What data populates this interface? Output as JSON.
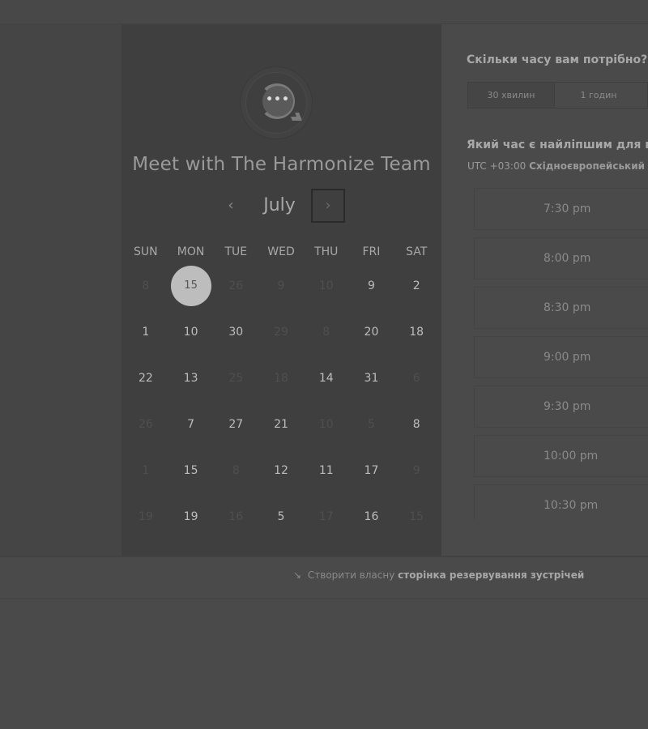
{
  "calendar": {
    "title": "Meet with The Harmonize Team",
    "logo_text": "•••",
    "month": "July",
    "prev_label": "‹",
    "next_label": "›",
    "days_of_week": [
      "SUN",
      "MON",
      "TUE",
      "WED",
      "THU",
      "FRI",
      "SAT"
    ],
    "weeks": [
      [
        {
          "d": "8",
          "m": true
        },
        {
          "d": "15",
          "sel": true
        },
        {
          "d": "26",
          "m": true
        },
        {
          "d": "9",
          "m": true
        },
        {
          "d": "10",
          "m": true
        },
        {
          "d": "9"
        },
        {
          "d": "2"
        }
      ],
      [
        {
          "d": "1"
        },
        {
          "d": "10"
        },
        {
          "d": "30"
        },
        {
          "d": "29",
          "m": true
        },
        {
          "d": "8",
          "m": true
        },
        {
          "d": "20"
        },
        {
          "d": "18"
        }
      ],
      [
        {
          "d": "22"
        },
        {
          "d": "13"
        },
        {
          "d": "25",
          "m": true
        },
        {
          "d": "18",
          "m": true
        },
        {
          "d": "14"
        },
        {
          "d": "31"
        },
        {
          "d": "6",
          "m": true
        }
      ],
      [
        {
          "d": "26",
          "m": true
        },
        {
          "d": "7"
        },
        {
          "d": "27"
        },
        {
          "d": "21"
        },
        {
          "d": "10",
          "m": true
        },
        {
          "d": "5",
          "m": true
        },
        {
          "d": "8"
        }
      ],
      [
        {
          "d": "1",
          "m": true
        },
        {
          "d": "15"
        },
        {
          "d": "8",
          "m": true
        },
        {
          "d": "12"
        },
        {
          "d": "11"
        },
        {
          "d": "17"
        },
        {
          "d": "9",
          "m": true
        }
      ],
      [
        {
          "d": "19",
          "m": true
        },
        {
          "d": "19"
        },
        {
          "d": "16",
          "m": true
        },
        {
          "d": "5"
        },
        {
          "d": "17",
          "m": true
        },
        {
          "d": "16"
        },
        {
          "d": "15",
          "m": true
        }
      ]
    ]
  },
  "booking": {
    "duration_question": "Скільки часу вам потрібно?",
    "durations": [
      "30 хвилин",
      "1 годин"
    ],
    "time_question": "Який час є найліпшим для вас?",
    "tz_offset": "UTC +03:00",
    "tz_name": "Східноєвропейський час",
    "slots": [
      "7:30 pm",
      "8:00 pm",
      "8:30 pm",
      "9:00 pm",
      "9:30 pm",
      "10:00 pm",
      "10:30 pm"
    ]
  },
  "footer": {
    "icon": "↘",
    "text": "Створити власну",
    "link": "сторінка резервування зустрічей"
  }
}
